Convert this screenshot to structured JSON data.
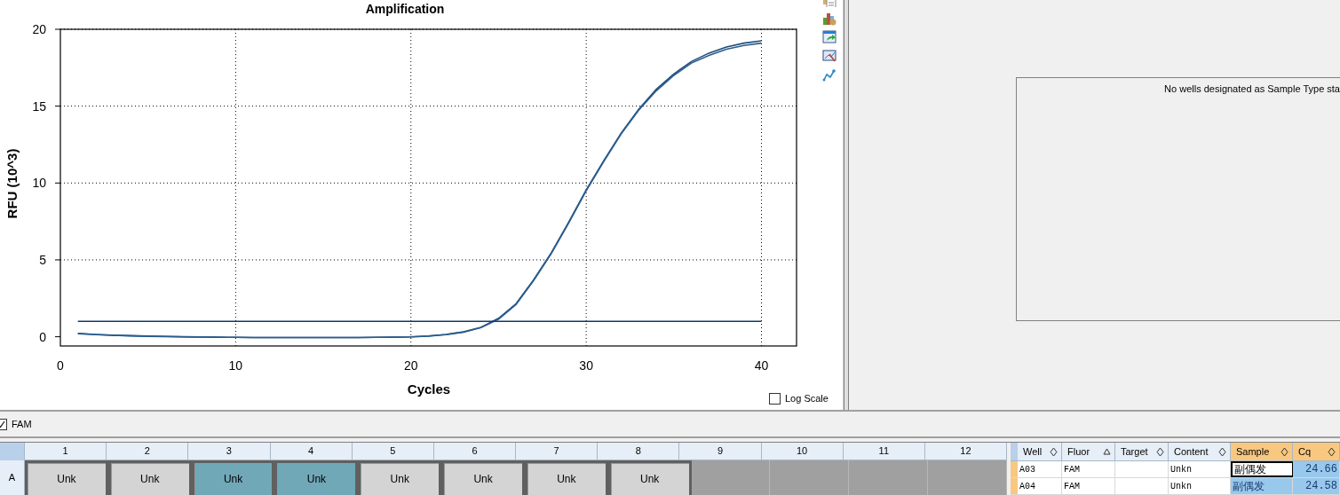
{
  "chart": {
    "chart_data": {
      "type": "line",
      "title": "Amplification",
      "xlabel": "Cycles",
      "ylabel": "RFU (10^3)",
      "x": [
        1,
        2,
        3,
        4,
        5,
        6,
        7,
        8,
        9,
        10,
        11,
        12,
        13,
        14,
        15,
        16,
        17,
        18,
        19,
        20,
        21,
        22,
        23,
        24,
        25,
        26,
        27,
        28,
        29,
        30,
        31,
        32,
        33,
        34,
        35,
        36,
        37,
        38,
        39,
        40
      ],
      "xlim": [
        0,
        42
      ],
      "ylim": [
        -0.6,
        20
      ],
      "xticks": [
        0,
        10,
        20,
        30,
        40
      ],
      "yticks": [
        0,
        5,
        10,
        15,
        20
      ],
      "grid": true,
      "series": [
        {
          "color": "#1f4e79",
          "values": [
            0.22,
            0.15,
            0.1,
            0.07,
            0.04,
            0.02,
            0.0,
            -0.02,
            -0.03,
            -0.04,
            -0.05,
            -0.05,
            -0.05,
            -0.05,
            -0.05,
            -0.05,
            -0.05,
            -0.04,
            -0.03,
            -0.01,
            0.05,
            0.15,
            0.32,
            0.62,
            1.2,
            2.15,
            3.7,
            5.45,
            7.45,
            9.55,
            11.45,
            13.25,
            14.8,
            16.1,
            17.1,
            17.9,
            18.45,
            18.85,
            19.1,
            19.25
          ]
        },
        {
          "color": "#2a5d8f",
          "values": [
            0.2,
            0.14,
            0.09,
            0.06,
            0.03,
            0.01,
            -0.01,
            -0.02,
            -0.03,
            -0.04,
            -0.05,
            -0.05,
            -0.05,
            -0.05,
            -0.05,
            -0.05,
            -0.05,
            -0.04,
            -0.03,
            -0.01,
            0.04,
            0.14,
            0.3,
            0.6,
            1.15,
            2.1,
            3.65,
            5.4,
            7.4,
            9.5,
            11.4,
            13.2,
            14.75,
            16.0,
            17.0,
            17.8,
            18.3,
            18.7,
            18.95,
            19.1
          ]
        },
        {
          "color": "#123a66",
          "values": [
            1.0,
            1.0,
            1.0,
            1.0,
            1.0,
            1.0,
            1.0,
            1.0,
            1.0,
            1.0,
            1.0,
            1.0,
            1.0,
            1.0,
            1.0,
            1.0,
            1.0,
            1.0,
            1.0,
            1.0,
            1.0,
            1.0,
            1.0,
            1.0,
            1.0,
            1.0,
            1.0,
            1.0,
            1.0,
            1.0,
            1.0,
            1.0,
            1.0,
            1.0,
            1.0,
            1.0,
            1.0,
            1.0,
            1.0,
            1.0
          ]
        }
      ]
    },
    "log_scale": {
      "label": "Log Scale",
      "checked": false
    }
  },
  "message": "No wells designated as Sample Type sta",
  "fluor_filter": {
    "label": "FAM",
    "checked": true
  },
  "plate": {
    "columns": [
      "1",
      "2",
      "3",
      "4",
      "5",
      "6",
      "7",
      "8",
      "9",
      "10",
      "11",
      "12"
    ],
    "rows": [
      {
        "label": "A",
        "wells": [
          {
            "kind": "sample",
            "content": "Unk",
            "selected": false
          },
          {
            "kind": "sample",
            "content": "Unk",
            "selected": false
          },
          {
            "kind": "sample",
            "content": "Unk",
            "selected": true
          },
          {
            "kind": "sample",
            "content": "Unk",
            "selected": true
          },
          {
            "kind": "sample",
            "content": "Unk",
            "selected": false
          },
          {
            "kind": "sample",
            "content": "Unk",
            "selected": false
          },
          {
            "kind": "sample",
            "content": "Unk",
            "selected": false
          },
          {
            "kind": "sample",
            "content": "Unk",
            "selected": false
          },
          {
            "kind": "empty"
          },
          {
            "kind": "empty"
          },
          {
            "kind": "empty"
          },
          {
            "kind": "empty"
          }
        ]
      }
    ]
  },
  "table": {
    "columns": [
      {
        "label": "Well",
        "sorted": false,
        "highlighted": false
      },
      {
        "label": "Fluor",
        "sorted": true,
        "highlighted": false
      },
      {
        "label": "Target",
        "sorted": false,
        "highlighted": false
      },
      {
        "label": "Content",
        "sorted": false,
        "highlighted": false
      },
      {
        "label": "Sample",
        "sorted": false,
        "highlighted": true
      },
      {
        "label": "Cq",
        "sorted": false,
        "highlighted": true
      }
    ],
    "rows": [
      {
        "well": "A03",
        "fluor": "FAM",
        "content": "Unkn",
        "sample": "副偶发",
        "cq": "24.66",
        "focused": true
      },
      {
        "well": "A04",
        "fluor": "FAM",
        "content": "Unkn",
        "sample": "副偶发",
        "cq": "24.58",
        "focused": false
      }
    ]
  }
}
